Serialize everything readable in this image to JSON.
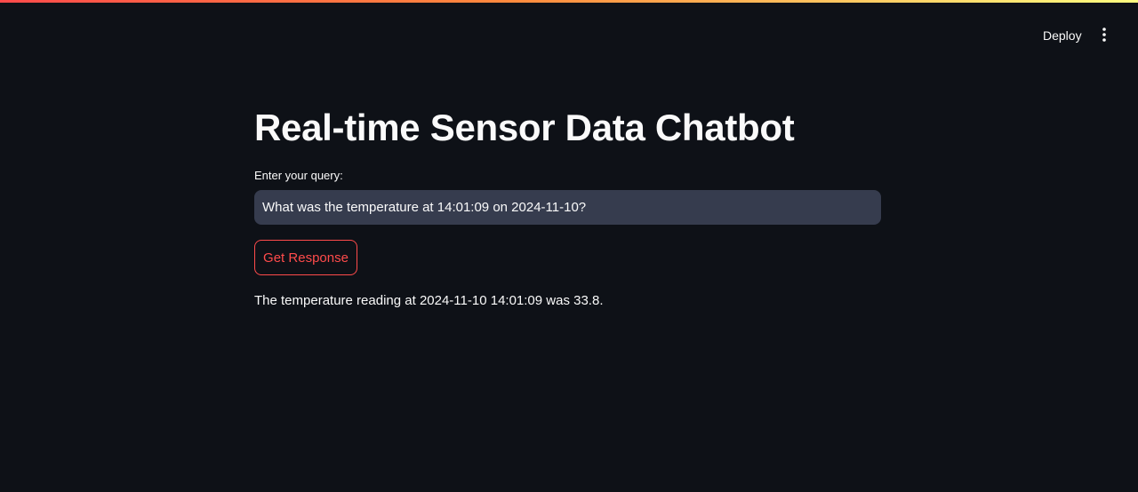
{
  "header": {
    "deploy_label": "Deploy",
    "menu_icon": "vertical-ellipsis-icon"
  },
  "colors": {
    "background": "#0e1117",
    "text": "#fafafa",
    "input_background": "#363c4e",
    "primary": "#ff4b4b",
    "decoration_gradient": [
      "#ff4b4b",
      "#ff8a3d",
      "#fffd80"
    ]
  },
  "main": {
    "title": "Real-time Sensor Data Chatbot",
    "query_label": "Enter your query:",
    "query_value": "What was the temperature at 14:01:09 on 2024-11-10?",
    "button_label": "Get Response",
    "response": "The temperature reading at 2024-11-10 14:01:09 was 33.8."
  }
}
